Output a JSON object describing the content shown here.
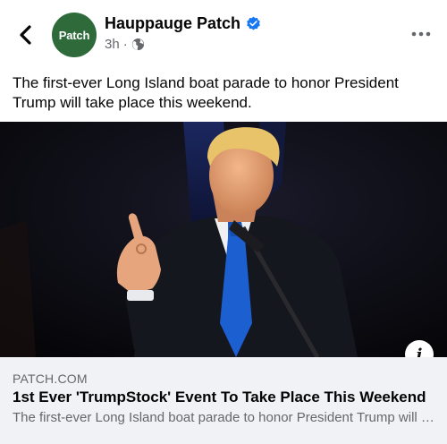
{
  "post": {
    "page_name": "Hauppauge Patch",
    "avatar_text": "Patch",
    "timestamp": "3h",
    "separator": "·",
    "audience_icon": "globe-icon",
    "text": "The first-ever Long Island boat parade to honor President Trump will take place this weekend."
  },
  "link": {
    "domain": "PATCH.COM",
    "title": "1st Ever 'TrumpStock' Event To Take Place This Weekend",
    "description": "The first-ever Long Island boat parade to honor President Trump will take place this weekend."
  },
  "icons": {
    "back": "chevron-left-icon",
    "verified": "verified-badge-icon",
    "more": "more-options-icon",
    "info": "info-icon"
  },
  "colors": {
    "brand_green": "#2f6b3a",
    "verified_blue": "#1877f2",
    "secondary_text": "#65676b",
    "link_card_bg": "#f0f2f5"
  }
}
